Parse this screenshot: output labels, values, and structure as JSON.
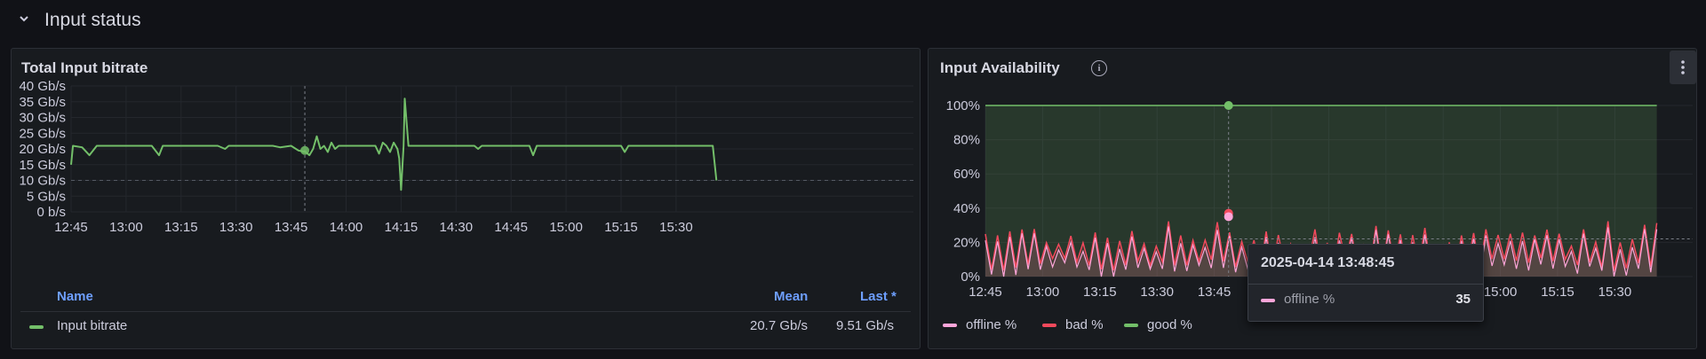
{
  "row": {
    "title": "Input status"
  },
  "panels": {
    "bitrate": {
      "title": "Total Input bitrate",
      "legend": {
        "headers": {
          "name": "Name",
          "mean": "Mean",
          "last": "Last *"
        },
        "rows": [
          {
            "name": "Input bitrate",
            "mean": "20.7 Gb/s",
            "last": "9.51 Gb/s",
            "color": "#73bf69"
          }
        ]
      }
    },
    "availability": {
      "title": "Input Availability",
      "info_icon": "info-icon",
      "menu_icon": "kebab-menu-icon",
      "legend": [
        {
          "name": "offline %",
          "color": "#ffa6da"
        },
        {
          "name": "bad %",
          "color": "#f2495c"
        },
        {
          "name": "good %",
          "color": "#73bf69"
        }
      ],
      "tooltip": {
        "time": "2025-04-14 13:48:45",
        "series": "offline %",
        "value": "35",
        "color": "#ffa6da"
      }
    }
  },
  "chart_data": [
    {
      "type": "line",
      "xlabel": "",
      "ylabel": "",
      "x_ticks": [
        "12:45",
        "13:00",
        "13:15",
        "13:30",
        "13:45",
        "14:00",
        "14:15",
        "14:30",
        "14:45",
        "15:00",
        "15:15",
        "15:30"
      ],
      "y_ticks": [
        "0 b/s",
        "5 Gb/s",
        "10 Gb/s",
        "15 Gb/s",
        "20 Gb/s",
        "25 Gb/s",
        "30 Gb/s",
        "35 Gb/s",
        "40 Gb/s"
      ],
      "ylim": [
        0,
        40
      ],
      "threshold": 10,
      "hover_time": "13:48:45",
      "series": [
        {
          "name": "Input bitrate",
          "color": "#73bf69",
          "points": [
            [
              "12:45",
              15
            ],
            [
              "12:45:30",
              21
            ],
            [
              "12:48",
              20.5
            ],
            [
              "12:50",
              18
            ],
            [
              "12:52",
              21
            ],
            [
              "12:58",
              21
            ],
            [
              "13:00",
              21
            ],
            [
              "13:07",
              21
            ],
            [
              "13:09",
              18
            ],
            [
              "13:10",
              21
            ],
            [
              "13:25",
              21
            ],
            [
              "13:27",
              20
            ],
            [
              "13:28",
              21
            ],
            [
              "13:40",
              21
            ],
            [
              "13:42",
              20.5
            ],
            [
              "13:45",
              21
            ],
            [
              "13:47",
              19.5
            ],
            [
              "13:49",
              19
            ],
            [
              "13:50",
              18
            ],
            [
              "13:51",
              20
            ],
            [
              "13:52",
              24
            ],
            [
              "13:53",
              20
            ],
            [
              "13:54",
              21
            ],
            [
              "13:55",
              19
            ],
            [
              "13:56",
              22
            ],
            [
              "13:57",
              20
            ],
            [
              "13:58",
              21
            ],
            [
              "14:08",
              21
            ],
            [
              "14:09",
              18.5
            ],
            [
              "14:10",
              22
            ],
            [
              "14:11",
              21
            ],
            [
              "14:12",
              19
            ],
            [
              "14:13",
              22
            ],
            [
              "14:14",
              20
            ],
            [
              "14:14:30",
              17
            ],
            [
              "14:15",
              7
            ],
            [
              "14:15:40",
              21
            ],
            [
              "14:16",
              36
            ],
            [
              "14:17",
              21
            ],
            [
              "14:35",
              21
            ],
            [
              "14:36",
              20
            ],
            [
              "14:37",
              21
            ],
            [
              "14:50",
              21
            ],
            [
              "14:51",
              18
            ],
            [
              "14:52",
              21
            ],
            [
              "15:15",
              21
            ],
            [
              "15:16",
              19
            ],
            [
              "15:17",
              21
            ],
            [
              "15:40",
              21
            ],
            [
              "15:41",
              10
            ]
          ]
        }
      ]
    },
    {
      "type": "area",
      "xlabel": "",
      "ylabel": "",
      "x_ticks": [
        "12:45",
        "13:00",
        "13:15",
        "13:30",
        "13:45",
        "14:00",
        "14:15",
        "14:30",
        "14:45",
        "15:00",
        "15:15",
        "15:30"
      ],
      "y_ticks": [
        "0%",
        "20%",
        "40%",
        "60%",
        "80%",
        "100%"
      ],
      "ylim": [
        0,
        100
      ],
      "hover_time": "13:48:45",
      "series": [
        {
          "name": "good %",
          "color": "#73bf69",
          "constant": 100
        },
        {
          "name": "bad %",
          "color": "#f2495c",
          "min": 3,
          "max": 33
        },
        {
          "name": "offline %",
          "color": "#ffa6da",
          "min": 3,
          "max": 31
        }
      ],
      "hover_values": {
        "good %": 100,
        "bad %": 37,
        "offline %": 35
      }
    }
  ]
}
